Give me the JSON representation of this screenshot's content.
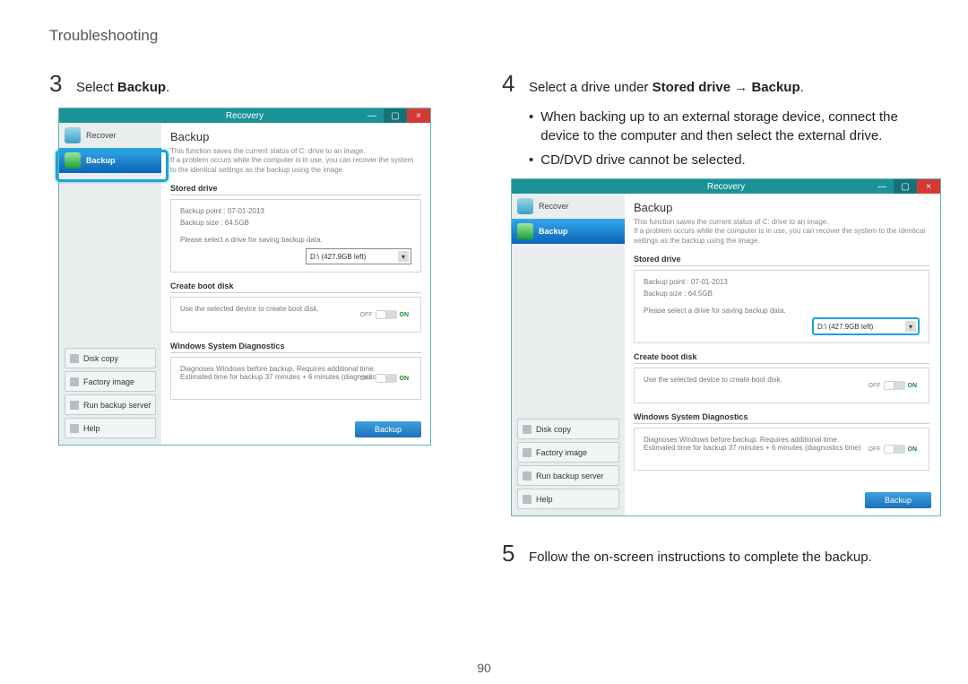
{
  "page_header": "Troubleshooting",
  "page_number": "90",
  "steps": {
    "s3": {
      "num": "3",
      "pre": "Select ",
      "bold": "Backup",
      "post": "."
    },
    "s4": {
      "num": "4",
      "pre": "Select a drive under ",
      "bold": "Stored drive → Backup",
      "post": "."
    },
    "s5": {
      "num": "5",
      "text": "Follow the on-screen instructions to complete the backup."
    }
  },
  "bullets": {
    "b1": "When backing up to an external storage device, connect the device to the computer and then select the external drive.",
    "b2": "CD/DVD drive cannot be selected."
  },
  "recovery_window": {
    "title": "Recovery",
    "win_btn_min": "—",
    "win_btn_max": "▢",
    "win_btn_close": "×",
    "sidebar": {
      "recover": "Recover",
      "backup": "Backup",
      "links": {
        "disk_copy": "Disk copy",
        "factory_image": "Factory image",
        "run_backup_server": "Run backup server",
        "help": "Help"
      }
    },
    "main": {
      "heading": "Backup",
      "desc_line1": "This function saves the current status of C: drive to an image.",
      "desc_line2": "If a problem occurs while the computer is in use, you can recover the system to the identical settings as the backup using the image.",
      "sec_stored": "Stored drive",
      "stored_line1": "Backup point : 07-01-2013",
      "stored_line2": "Backup size : 64.5GB",
      "stored_line3": "Please select a drive for saving backup data.",
      "dropdown_value": "D:\\ (427.9GB left)",
      "sec_create": "Create boot disk",
      "create_line": "Use the selected device to create boot disk.",
      "sec_diag": "Windows System Diagnostics",
      "diag_line1": "Diagnoses Windows before backup. Requires additional time.",
      "diag_line2": "Estimated time for backup 37 minutes + 6 minutes (diagnostics time)",
      "toggle_off": "OFF",
      "toggle_on": "ON",
      "button": "Backup"
    }
  }
}
